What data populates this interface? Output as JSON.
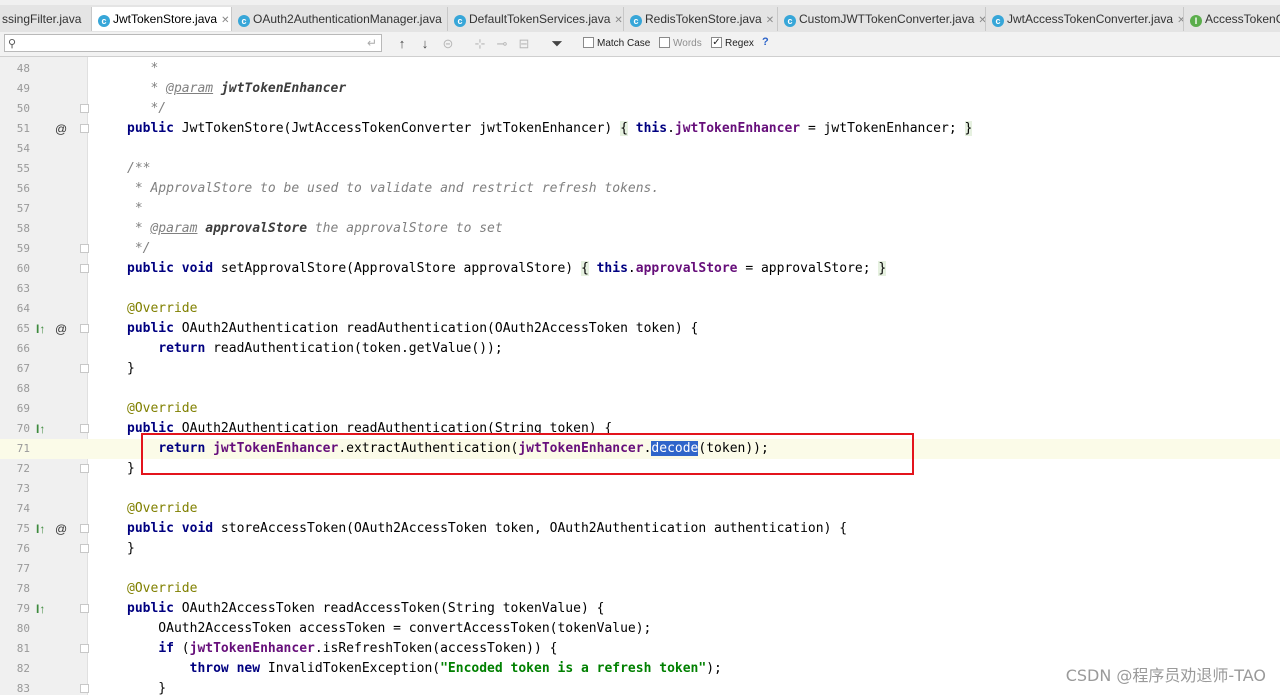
{
  "tabs": [
    {
      "label": "ssingFilter.java",
      "icon": "java-class-icon",
      "active": false
    },
    {
      "label": "JwtTokenStore.java",
      "icon": "java-class-icon",
      "active": true
    },
    {
      "label": "OAuth2AuthenticationManager.java",
      "icon": "java-class-icon",
      "active": false
    },
    {
      "label": "DefaultTokenServices.java",
      "icon": "java-class-icon",
      "active": false
    },
    {
      "label": "RedisTokenStore.java",
      "icon": "java-class-icon",
      "active": false
    },
    {
      "label": "CustomJWTTokenConverter.java",
      "icon": "java-class-icon",
      "active": false
    },
    {
      "label": "JwtAccessTokenConverter.java",
      "icon": "java-class-icon",
      "active": false
    },
    {
      "label": "AccessTokenC",
      "icon": "java-interface-icon",
      "active": false
    }
  ],
  "search": {
    "value": "",
    "placeholder": "",
    "match_case_label": "Match Case",
    "match_case_checked": false,
    "words_label": "Words",
    "words_checked": false,
    "regex_label": "Regex",
    "regex_checked": true,
    "help_label": "?"
  },
  "editor": {
    "line_numbers": [
      "48",
      "49",
      "50",
      "51",
      "54",
      "55",
      "56",
      "57",
      "58",
      "59",
      "60",
      "63",
      "64",
      "65",
      "66",
      "67",
      "68",
      "69",
      "70",
      "71",
      "72",
      "73",
      "74",
      "75",
      "76",
      "77",
      "78",
      "79",
      "80",
      "81",
      "82",
      "83"
    ],
    "code_lines": [
      "     *",
      "     * @param jwtTokenEnhancer",
      "     */",
      "public JwtTokenStore(JwtAccessTokenConverter jwtTokenEnhancer) { this.jwtTokenEnhancer = jwtTokenEnhancer; }",
      "",
      "/**",
      " * ApprovalStore to be used to validate and restrict refresh tokens.",
      " *",
      " * @param approvalStore the approvalStore to set",
      " */",
      "public void setApprovalStore(ApprovalStore approvalStore) { this.approvalStore = approvalStore; }",
      "",
      "@Override",
      "public OAuth2Authentication readAuthentication(OAuth2AccessToken token) {",
      "    return readAuthentication(token.getValue());",
      "}",
      "",
      "@Override",
      "public OAuth2Authentication readAuthentication(String token) {",
      "    return jwtTokenEnhancer.extractAuthentication(jwtTokenEnhancer.decode(token));",
      "}",
      "",
      "@Override",
      "public void storeAccessToken(OAuth2AccessToken token, OAuth2Authentication authentication) {",
      "}",
      "",
      "@Override",
      "public OAuth2AccessToken readAccessToken(String tokenValue) {",
      "    OAuth2AccessToken accessToken = convertAccessToken(tokenValue);",
      "    if (jwtTokenEnhancer.isRefreshToken(accessToken)) {",
      "        throw new InvalidTokenException(\"Encoded token is a refresh token\");",
      "    }"
    ],
    "selected_text": "decode",
    "current_line": "71"
  },
  "watermark": "CSDN @程序员劝退师-TAO"
}
